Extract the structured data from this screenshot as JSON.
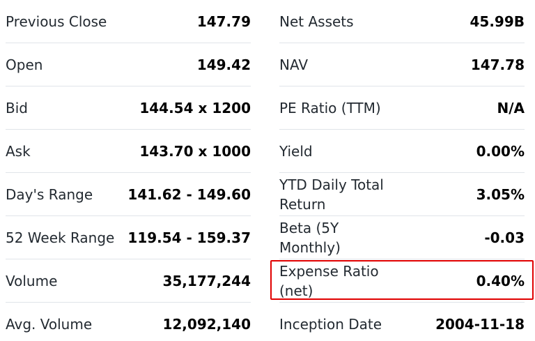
{
  "left": [
    {
      "label": "Previous Close",
      "value": "147.79"
    },
    {
      "label": "Open",
      "value": "149.42"
    },
    {
      "label": "Bid",
      "value": "144.54 x 1200"
    },
    {
      "label": "Ask",
      "value": "143.70 x 1000"
    },
    {
      "label": "Day's Range",
      "value": "141.62 - 149.60"
    },
    {
      "label": "52 Week Range",
      "value": "119.54 - 159.37"
    },
    {
      "label": "Volume",
      "value": "35,177,244"
    },
    {
      "label": "Avg. Volume",
      "value": "12,092,140"
    }
  ],
  "right": [
    {
      "label": "Net Assets",
      "value": "45.99B"
    },
    {
      "label": "NAV",
      "value": "147.78"
    },
    {
      "label": "PE Ratio (TTM)",
      "value": "N/A"
    },
    {
      "label": "Yield",
      "value": "0.00%"
    },
    {
      "label": "YTD Daily Total Return",
      "value": "3.05%"
    },
    {
      "label": "Beta (5Y Monthly)",
      "value": "-0.03"
    },
    {
      "label": "Expense Ratio (net)",
      "value": "0.40%"
    },
    {
      "label": "Inception Date",
      "value": "2004-11-18"
    }
  ],
  "highlight_color": "#e00000"
}
